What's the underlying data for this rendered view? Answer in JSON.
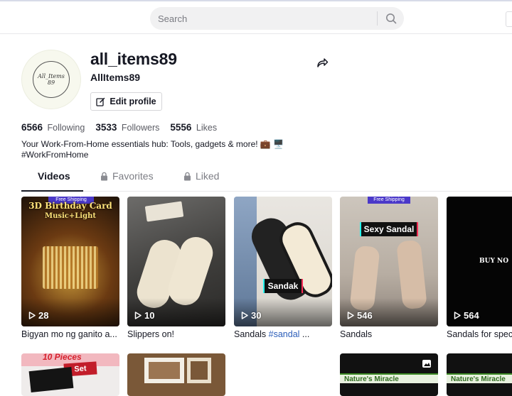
{
  "search": {
    "placeholder": "Search"
  },
  "profile": {
    "username": "all_items89",
    "nickname": "AllItems89",
    "edit_label": "Edit profile",
    "avatar_text_1": "All_Items",
    "avatar_text_2": "89"
  },
  "stats": [
    {
      "value": "6566",
      "label": "Following"
    },
    {
      "value": "3533",
      "label": "Followers"
    },
    {
      "value": "5556",
      "label": "Likes"
    }
  ],
  "bio": {
    "line1": "Your Work-From-Home essentials hub: Tools, gadgets & more! 💼 🖥️",
    "line2": "#WorkFromHome"
  },
  "tabs": [
    {
      "label": "Videos"
    },
    {
      "label": "Favorites"
    },
    {
      "label": "Liked"
    }
  ],
  "videos": [
    {
      "views": "28",
      "caption": "Bigyan mo ng ganito a...",
      "overlay_top": "Free Shipping",
      "overlay_title": "3D Birthday Card",
      "overlay_sub": "Music+Light"
    },
    {
      "views": "10",
      "caption": "Slippers on!"
    },
    {
      "views": "30",
      "caption_text": "Sandals ",
      "caption_tag": "#sandal",
      "caption_rest": " ...",
      "overlay_label": "Sandak"
    },
    {
      "views": "546",
      "caption": "Sandals",
      "overlay_top": "Free Shipping",
      "overlay_label": "Sexy Sandal"
    },
    {
      "views": "564",
      "caption": "Sandals for speci",
      "overlay_label": "BUY NO"
    }
  ],
  "row2": [
    {
      "overlay": "10 Pieces",
      "overlay_sub": "Set"
    },
    {
      "overlay": ""
    },
    {
      "overlay": ""
    },
    {
      "overlay": "Nature's Miracle"
    },
    {
      "overlay": "Nature's Miracle"
    }
  ],
  "colors": {
    "accent": "#161823",
    "link": "#2b5db9",
    "search_bg": "#f1f1f2"
  }
}
